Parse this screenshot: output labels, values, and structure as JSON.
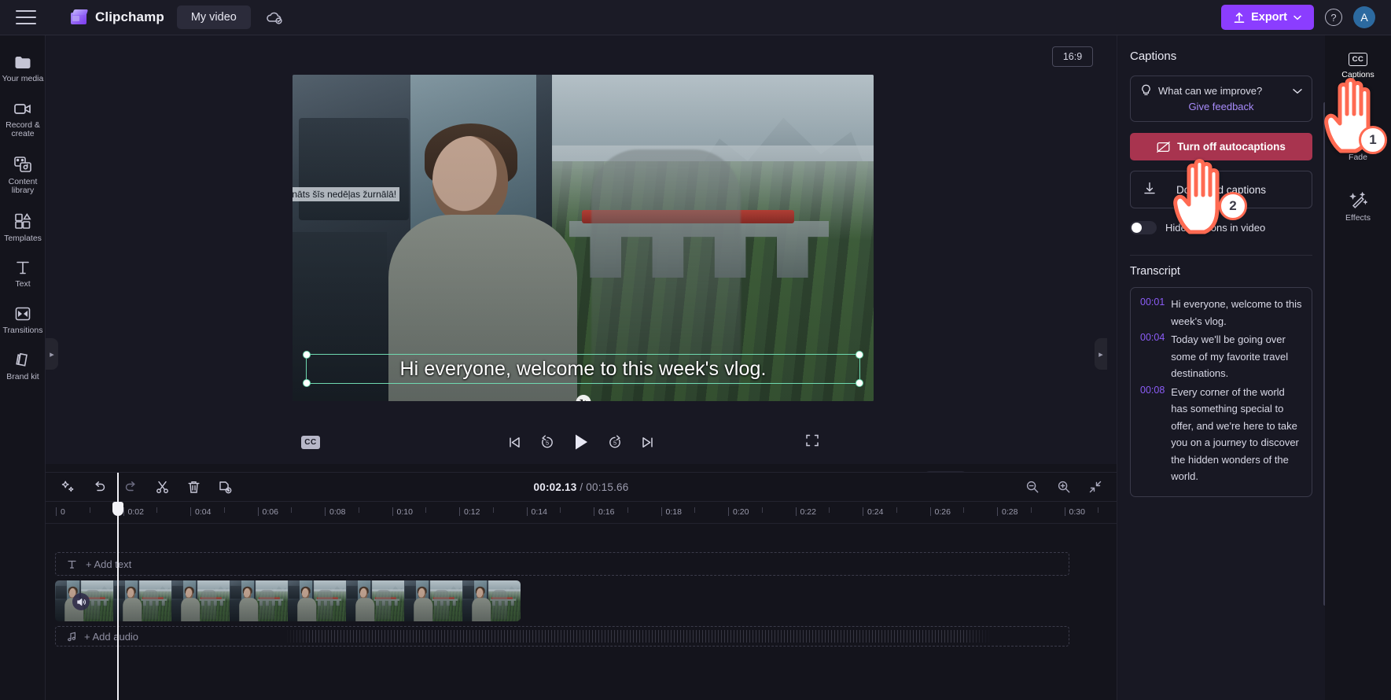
{
  "topbar": {
    "menu_icon": "hamburger-icon",
    "brand": "Clipchamp",
    "project_name": "My video",
    "cloud_icon": "cloud-sync-icon",
    "export_label": "Export",
    "export_color": "#8b3dff",
    "help_icon": "help-icon",
    "avatar_initial": "A"
  },
  "sidebar": {
    "items": [
      {
        "label": "Your media",
        "icon": "folder-icon"
      },
      {
        "label": "Record & create",
        "icon": "video-camera-icon"
      },
      {
        "label": "Content library",
        "icon": "content-library-icon"
      },
      {
        "label": "Templates",
        "icon": "templates-icon"
      },
      {
        "label": "Text",
        "icon": "text-icon"
      },
      {
        "label": "Transitions",
        "icon": "transitions-icon"
      },
      {
        "label": "Brand kit",
        "icon": "brand-kit-icon"
      }
    ]
  },
  "preview": {
    "aspect_ratio": "16:9",
    "overlay_subtitle": "Labdien, sveicināts šīs nedēļas žurnālā!",
    "caption_text": "Hi everyone, welcome to this week's vlog.",
    "selection_color": "#6fd9b0",
    "rotate_icon": "rotate-handle-icon",
    "controls": {
      "cc_label": "CC",
      "skip_back_icon": "skip-to-start-icon",
      "rewind_icon": "rewind-5s-icon",
      "play_icon": "play-icon",
      "forward_icon": "forward-5s-icon",
      "skip_forward_icon": "skip-to-end-icon",
      "fullscreen_icon": "fullscreen-icon"
    }
  },
  "timeline": {
    "tools": [
      {
        "name": "magic-icon"
      },
      {
        "name": "undo-icon"
      },
      {
        "name": "redo-icon"
      },
      {
        "name": "split-icon"
      },
      {
        "name": "delete-icon"
      },
      {
        "name": "duplicate-icon"
      }
    ],
    "current_time": "00:02.13",
    "separator": " / ",
    "total_time": "00:15.66",
    "zoom_tools": [
      {
        "name": "zoom-out-icon"
      },
      {
        "name": "zoom-in-icon"
      },
      {
        "name": "fit-to-screen-icon"
      }
    ],
    "ruler_marks": [
      "0",
      "0:02",
      "0:04",
      "0:06",
      "0:08",
      "0:10",
      "0:12",
      "0:14",
      "0:16",
      "0:18",
      "0:20",
      "0:22",
      "0:24",
      "0:26",
      "0:28",
      "0:30"
    ],
    "add_text_label": "+ Add text",
    "add_audio_label": "+ Add audio",
    "text_track_icon": "text-icon",
    "audio_track_icon": "music-note-icon",
    "video_clip_icon": "speaker-icon"
  },
  "captions_panel": {
    "title": "Captions",
    "feedback_prompt": "What can we improve?",
    "feedback_link": "Give feedback",
    "lightbulb_icon": "lightbulb-icon",
    "chevron_icon": "chevron-down-icon",
    "turn_off_label": "Turn off autocaptions",
    "turn_off_icon": "captions-off-icon",
    "turn_off_color": "#a8344f",
    "download_label": "Download captions",
    "download_icon": "download-icon",
    "hide_captions_label": "Hide captions in video",
    "hide_captions_on": false,
    "transcript_title": "Transcript",
    "transcript": [
      {
        "time": "00:01",
        "text": "Hi everyone, welcome to this week's vlog."
      },
      {
        "time": "00:04",
        "text": "Today we'll be going over some of my favorite travel destinations."
      },
      {
        "time": "00:08",
        "text": "Every corner of the world has something special to offer, and we're here to take you on a journey to discover the hidden wonders of the world."
      }
    ],
    "timestamp_color": "#8b5cf6"
  },
  "toolrail": {
    "items": [
      {
        "label": "Captions",
        "icon": "cc-icon",
        "active": true
      },
      {
        "label": "Fade",
        "icon": "fade-icon",
        "active": false
      },
      {
        "label": "Effects",
        "icon": "effects-icon",
        "active": false
      }
    ]
  },
  "annotations": {
    "steps": [
      {
        "number": "1",
        "target": "captions-tool-rail-item"
      },
      {
        "number": "2",
        "target": "turn-off-autocaptions-button"
      }
    ],
    "cursor_icon": "pointing-hand-cursor",
    "accent_color": "#ff6a52"
  }
}
